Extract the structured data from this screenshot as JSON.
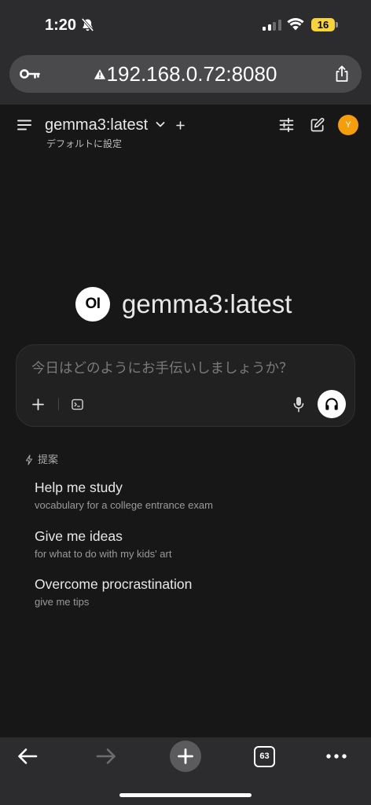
{
  "status_bar": {
    "time": "1:20",
    "battery_percent": "16",
    "signal_bars": 2,
    "signal_bars_max": 4,
    "icons": [
      "bell-slash-icon",
      "signal-icon",
      "wifi-icon",
      "battery-icon"
    ]
  },
  "browser": {
    "url": "192.168.0.72:8080",
    "tab_count": "63",
    "icons": [
      "key-icon",
      "not-secure-warning-icon",
      "share-icon",
      "back-arrow-icon",
      "forward-arrow-icon",
      "plus-icon",
      "tabs-icon",
      "more-icon"
    ]
  },
  "header": {
    "model_name": "gemma3:latest",
    "set_default_label": "デフォルトに設定",
    "avatar_initial": "Y",
    "icons": [
      "menu-icon",
      "chevron-down-icon",
      "plus-icon",
      "sliders-icon",
      "edit-icon"
    ]
  },
  "hero": {
    "logo_text": "OI",
    "model_name": "gemma3:latest"
  },
  "composer": {
    "placeholder": "今日はどのようにお手伝いしましょうか？",
    "icons": [
      "plus-icon",
      "terminal-icon",
      "microphone-icon",
      "headphones-icon"
    ]
  },
  "suggestions": {
    "heading": "提案",
    "heading_icon": "bolt-icon",
    "items": [
      {
        "title": "Help me study",
        "subtitle": "vocabulary for a college entrance exam"
      },
      {
        "title": "Give me ideas",
        "subtitle": "for what to do with my kids' art"
      },
      {
        "title": "Overcome procrastination",
        "subtitle": "give me tips"
      }
    ]
  },
  "colors": {
    "browser_chrome": "#2c2c2e",
    "url_pill": "#4a4a4c",
    "app_background": "#171717",
    "composer_background": "#212121",
    "avatar": "#f59e0b",
    "battery_low_power": "#f7d33a",
    "headphone_button": "#ffffff"
  }
}
